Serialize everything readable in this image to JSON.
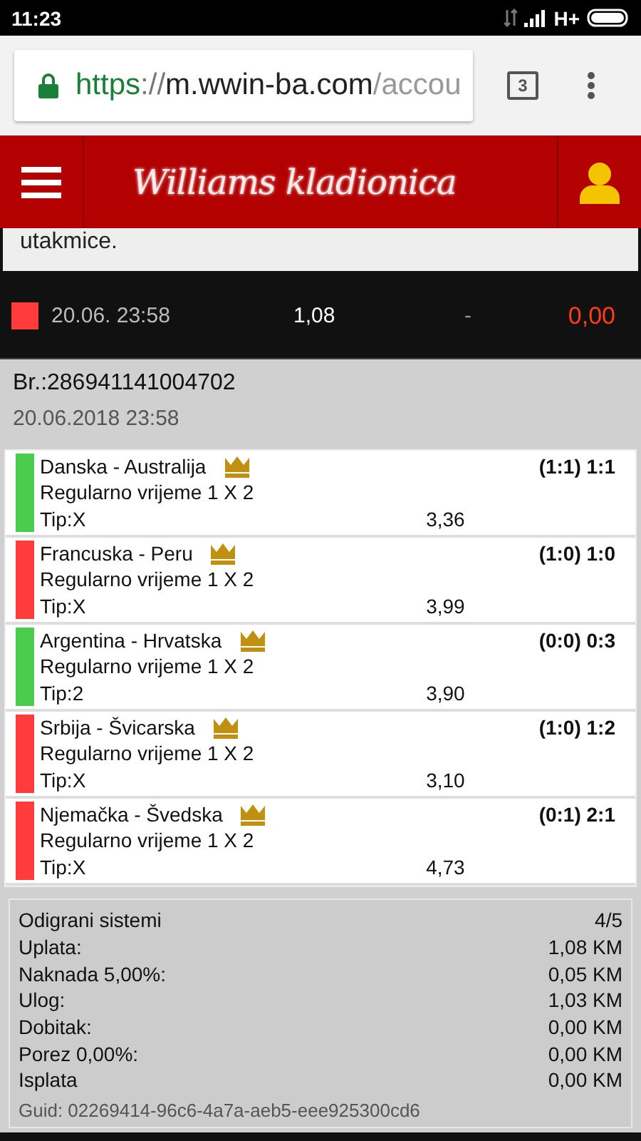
{
  "status_bar": {
    "time": "11:23",
    "network": "H+"
  },
  "browser": {
    "url_scheme": "https",
    "url_sep": "://",
    "url_host": "m.wwin-ba.com",
    "url_path": "/accou",
    "tab_count": "3"
  },
  "header": {
    "logo": "Williams kladionica"
  },
  "notice": {
    "text": "utakmice."
  },
  "ticket_row": {
    "color": "#ff3b3b",
    "date": "20.06. 23:58",
    "stake": "1,08",
    "status": "-",
    "payout": "0,00"
  },
  "ticket": {
    "number": "Br.:286941141004702",
    "date": "20.06.2018 23:58"
  },
  "matches": [
    {
      "teams": "Danska - Australija",
      "market": "Regularno vrijeme 1 X 2",
      "tip": "Tip:X",
      "odds": "3,36",
      "score": "(1:1) 1:1",
      "color": "#4ccc4c"
    },
    {
      "teams": "Francuska - Peru",
      "market": "Regularno vrijeme 1 X 2",
      "tip": "Tip:X",
      "odds": "3,99",
      "score": "(1:0) 1:0",
      "color": "#ff3b3b"
    },
    {
      "teams": "Argentina - Hrvatska",
      "market": "Regularno vrijeme 1 X 2",
      "tip": "Tip:2",
      "odds": "3,90",
      "score": "(0:0) 0:3",
      "color": "#4ccc4c"
    },
    {
      "teams": "Srbija - Švicarska",
      "market": "Regularno vrijeme 1 X 2",
      "tip": "Tip:X",
      "odds": "3,10",
      "score": "(1:0) 1:2",
      "color": "#ff3b3b"
    },
    {
      "teams": "Njemačka - Švedska",
      "market": "Regularno vrijeme 1 X 2",
      "tip": "Tip:X",
      "odds": "4,73",
      "score": "(0:1) 2:1",
      "color": "#ff3b3b"
    }
  ],
  "summary": {
    "rows": [
      {
        "label": "Odigrani sistemi",
        "value": "4/5"
      },
      {
        "label": "Uplata:",
        "value": "1,08 KM"
      },
      {
        "label": "Naknada 5,00%:",
        "value": "0,05 KM"
      },
      {
        "label": "Ulog:",
        "value": "1,03 KM"
      },
      {
        "label": "Dobitak:",
        "value": "0,00 KM"
      },
      {
        "label": "Porez 0,00%:",
        "value": "0,00 KM"
      },
      {
        "label": "Isplata",
        "value": "0,00 KM"
      }
    ],
    "guid": "Guid: 02269414-96c6-4a7a-aeb5-eee925300cd6"
  }
}
